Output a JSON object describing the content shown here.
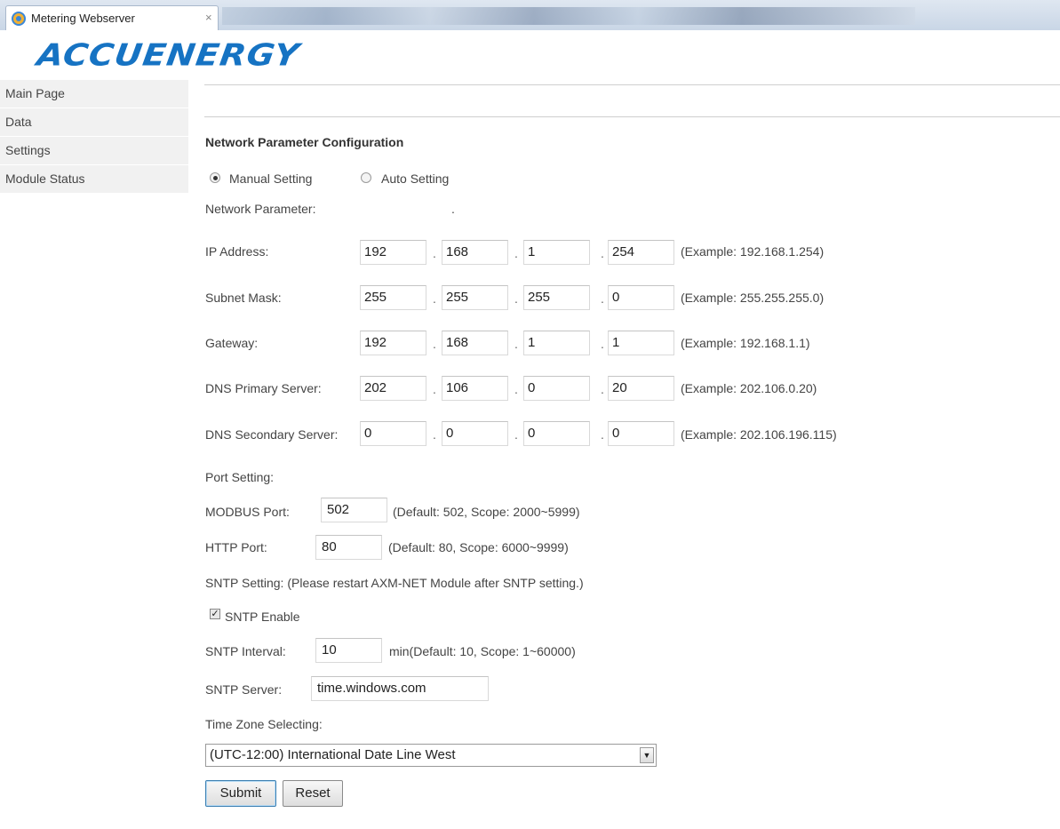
{
  "browser": {
    "tab_title": "Metering Webserver",
    "tab_close": "×"
  },
  "logo": {
    "text": "ACCUENERGY"
  },
  "sidebar": {
    "items": [
      {
        "label": "Main Page"
      },
      {
        "label": "Data"
      },
      {
        "label": "Settings"
      },
      {
        "label": "Module Status"
      }
    ]
  },
  "form": {
    "title": "Network Parameter Configuration",
    "mode": {
      "manual_label": "Manual Setting",
      "auto_label": "Auto Setting",
      "selected": "manual"
    },
    "network_parameter_label": "Network Parameter:",
    "network_parameter_dot": ".",
    "ip_rows": [
      {
        "label": "IP Address:",
        "octets": [
          "192",
          "168",
          "1",
          "254"
        ],
        "example": "(Example: 192.168.1.254)"
      },
      {
        "label": "Subnet Mask:",
        "octets": [
          "255",
          "255",
          "255",
          "0"
        ],
        "example": "(Example: 255.255.255.0)"
      },
      {
        "label": "Gateway:",
        "octets": [
          "192",
          "168",
          "1",
          "1"
        ],
        "example": "(Example: 192.168.1.1)"
      },
      {
        "label": "DNS Primary Server:",
        "octets": [
          "202",
          "106",
          "0",
          "20"
        ],
        "example": "(Example: 202.106.0.20)"
      },
      {
        "label": "DNS Secondary Server:",
        "octets": [
          "0",
          "0",
          "0",
          "0"
        ],
        "example": "(Example: 202.106.196.115)"
      }
    ],
    "octet_separator": ".",
    "port_setting_label": "Port Setting:",
    "modbus": {
      "label": "MODBUS Port:",
      "value": "502",
      "hint": "(Default: 502, Scope: 2000~5999)"
    },
    "http": {
      "label": "HTTP Port:",
      "value": "80",
      "hint": "(Default: 80, Scope: 6000~9999)"
    },
    "sntp_setting_label": "SNTP Setting: (Please restart AXM-NET Module after SNTP setting.)",
    "sntp_enable": {
      "label": "SNTP Enable",
      "checked": true,
      "mark": "✓"
    },
    "sntp_interval": {
      "label": "SNTP Interval:",
      "value": "10",
      "hint": "min(Default: 10, Scope: 1~60000)"
    },
    "sntp_server": {
      "label": "SNTP Server:",
      "value": "time.windows.com"
    },
    "time_zone_label": "Time Zone Selecting:",
    "time_zone_value": "(UTC-12:00) International Date Line West",
    "select_arrow": "▼",
    "submit_label": "Submit",
    "reset_label": "Reset"
  },
  "colors": {
    "logo_blue": "#1673c3",
    "sidebar_bg": "#f1f1f1",
    "submit_border": "#3c7fb1"
  }
}
